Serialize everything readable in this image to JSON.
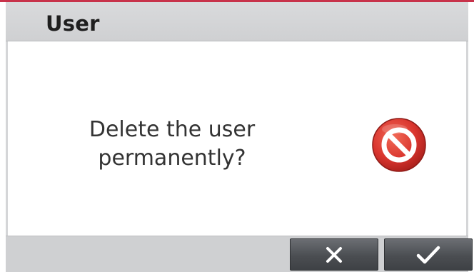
{
  "dialog": {
    "title": "User",
    "message_line1": "Delete the user",
    "message_line2": "permanently?"
  },
  "icons": {
    "status": "no-entry-icon",
    "cancel": "close-icon",
    "confirm": "checkmark-icon"
  },
  "colors": {
    "accent_line": "#c8324a",
    "icon_red": "#d9352e",
    "button_dark": "#4b4e52"
  }
}
